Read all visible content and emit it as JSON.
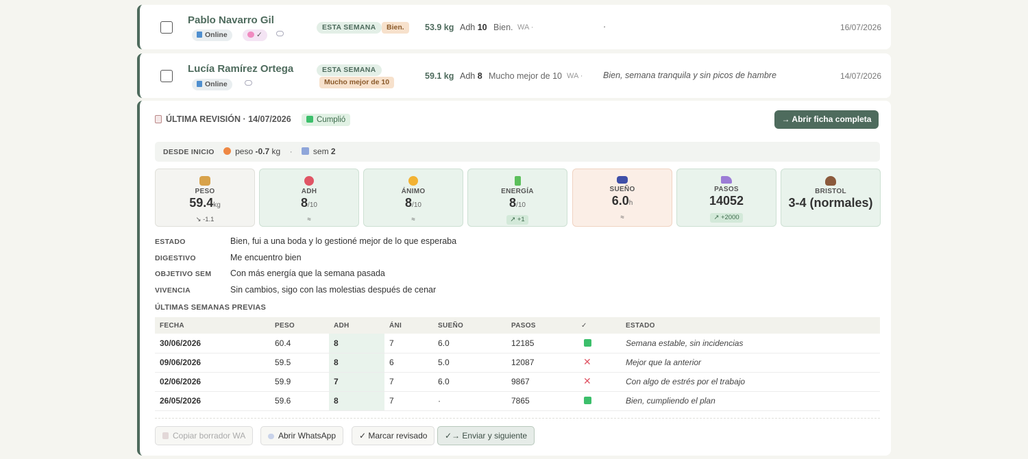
{
  "patients": [
    {
      "name": "Pablo Navarro Gil",
      "online": "Online",
      "brain_badge": "✓",
      "week_tag": "ESTA SEMANA",
      "status_tag": "Bien.",
      "weight": "53.9 kg",
      "adh_label": "Adh",
      "adh_value": "10",
      "status_text": "Bien.",
      "wa": "WA ·",
      "note": "·",
      "date": "16/07/2026"
    },
    {
      "name": "Lucía Ramírez Ortega",
      "online": "Online",
      "week_tag": "ESTA SEMANA",
      "status_tag": "Mucho mejor de 10",
      "weight": "59.1 kg",
      "adh_label": "Adh",
      "adh_value": "8",
      "status_text": "Mucho mejor de 10",
      "wa": "WA ·",
      "note": "Bien, semana tranquila y sin picos de hambre",
      "date": "14/07/2026"
    }
  ],
  "review": {
    "title": "ÚLTIMA REVISIÓN · 14/07/2026",
    "cumplio": "Cumplió",
    "open_button": "→ Abrir ficha completa",
    "since": {
      "label": "DESDE INICIO",
      "weight_label": "peso",
      "weight_delta": "-0.7",
      "weight_unit": "kg",
      "sep": "·",
      "weeks_label": "sem",
      "weeks": "2"
    },
    "metrics": [
      {
        "icon": "scale-icon",
        "label": "PESO",
        "value": "59.4",
        "unit": "kg",
        "trend": "↘ -1.1",
        "color": "#d8a24a"
      },
      {
        "icon": "target-icon",
        "label": "ADH",
        "value": "8",
        "unit": "/10",
        "trend": "≈",
        "color": "#e05565"
      },
      {
        "icon": "smile-icon",
        "label": "ÁNIMO",
        "value": "8",
        "unit": "/10",
        "trend": "≈",
        "color": "#f2b233"
      },
      {
        "icon": "battery-icon",
        "label": "ENERGÍA",
        "value": "8",
        "unit": "/10",
        "trend": "↗ +1",
        "color": "#5bbf5b"
      },
      {
        "icon": "bed-icon",
        "label": "SUEÑO",
        "value": "6.0",
        "unit": "h",
        "trend": "≈",
        "color": "#3f4fa8"
      },
      {
        "icon": "shoe-icon",
        "label": "PASOS",
        "value": "14052",
        "unit": "",
        "trend": "↗ +2000",
        "color": "#9c7cd6"
      },
      {
        "icon": "poop-icon",
        "label": "BRISTOL",
        "value": "3-4 (normales)",
        "unit": "",
        "trend": "",
        "color": "#8b5a3c"
      }
    ],
    "fields": [
      {
        "key": "ESTADO",
        "value": "Bien, fui a una boda y lo gestioné mejor de lo que esperaba"
      },
      {
        "key": "DIGESTIVO",
        "value": "Me encuentro bien"
      },
      {
        "key": "OBJETIVO SEM",
        "value": "Con más energía que la semana pasada"
      },
      {
        "key": "VIVENCIA",
        "value": "Sin cambios, sigo con las molestias después de cenar"
      }
    ],
    "previous_title": "ÚLTIMAS SEMANAS PREVIAS",
    "table": {
      "headers": [
        "FECHA",
        "PESO",
        "ADH",
        "ÁNI",
        "SUEÑO",
        "PASOS",
        "✓",
        "ESTADO"
      ],
      "rows": [
        {
          "date": "30/06/2026",
          "peso": "60.4",
          "adh": "8",
          "ani": "7",
          "sueno": "6.0",
          "pasos": "12185",
          "ok": true,
          "estado": "Semana estable, sin incidencias"
        },
        {
          "date": "09/06/2026",
          "peso": "59.5",
          "adh": "8",
          "ani": "6",
          "sueno": "5.0",
          "pasos": "12087",
          "ok": false,
          "estado": "Mejor que la anterior"
        },
        {
          "date": "02/06/2026",
          "peso": "59.9",
          "adh": "7",
          "ani": "7",
          "sueno": "6.0",
          "pasos": "9867",
          "ok": false,
          "estado": "Con algo de estrés por el trabajo"
        },
        {
          "date": "26/05/2026",
          "peso": "59.6",
          "adh": "8",
          "ani": "7",
          "sueno": "·",
          "pasos": "7865",
          "ok": true,
          "estado": "Bien, cumpliendo el plan"
        }
      ]
    },
    "buttons": {
      "copy": "Copiar borrador WA",
      "whatsapp": "Abrir WhatsApp",
      "mark": "✓ Marcar revisado",
      "send": "✓→ Enviar y siguiente"
    }
  }
}
